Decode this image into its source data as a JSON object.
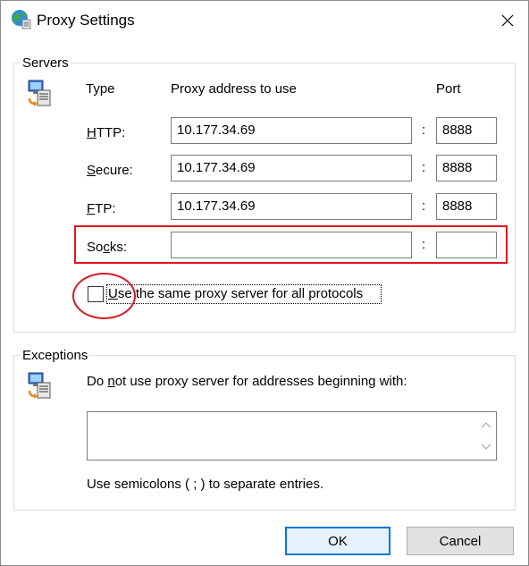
{
  "window": {
    "title": "Proxy Settings"
  },
  "servers": {
    "group_label": "Servers",
    "col_type": "Type",
    "col_address": "Proxy address to use",
    "col_port": "Port",
    "rows": [
      {
        "label_pre": "",
        "label_u": "H",
        "label_post": "TTP:",
        "address": "10.177.34.69",
        "port": "8888"
      },
      {
        "label_pre": "",
        "label_u": "S",
        "label_post": "ecure:",
        "address": "10.177.34.69",
        "port": "8888"
      },
      {
        "label_pre": "",
        "label_u": "F",
        "label_post": "TP:",
        "address": "10.177.34.69",
        "port": "8888"
      },
      {
        "label_pre": "So",
        "label_u": "c",
        "label_post": "ks:",
        "address": "",
        "port": ""
      }
    ],
    "colon": ":",
    "same_proxy_u": "U",
    "same_proxy_rest": "se the same proxy server for all protocols",
    "same_proxy_checked": false
  },
  "exceptions": {
    "group_label": "Exceptions",
    "desc_pre": "Do ",
    "desc_u": "n",
    "desc_post": "ot use proxy server for addresses beginning with:",
    "value": "",
    "hint": "Use semicolons ( ; ) to separate entries."
  },
  "buttons": {
    "ok": "OK",
    "cancel": "Cancel"
  },
  "colors": {
    "highlight": "#e0141e",
    "default_button_border": "#0078d7"
  }
}
